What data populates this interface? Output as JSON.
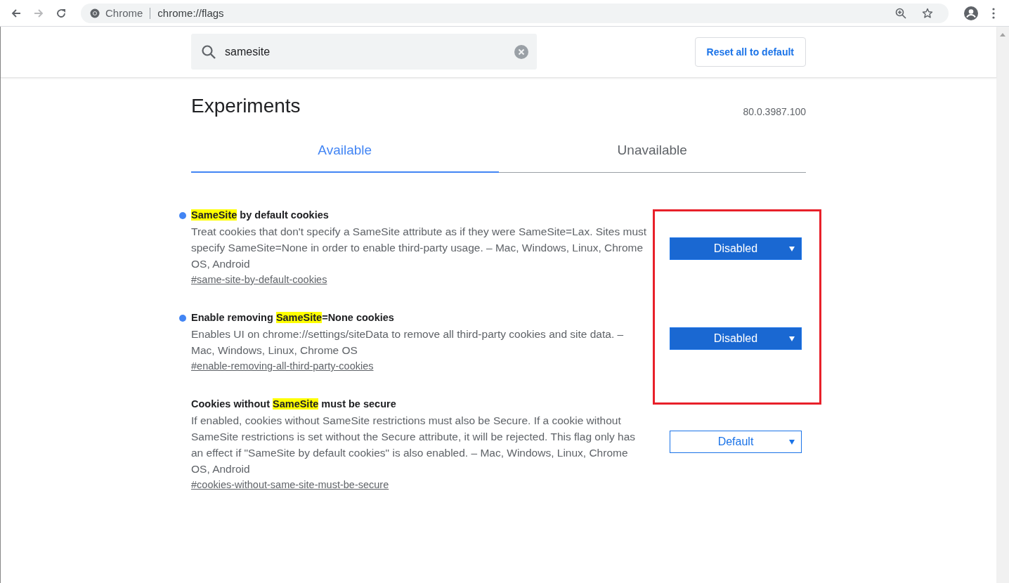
{
  "toolbar": {
    "origin_label": "Chrome",
    "url": "chrome://flags",
    "forward_disabled": true
  },
  "search": {
    "value": "samesite"
  },
  "reset_button": "Reset all to default",
  "title": "Experiments",
  "version": "80.0.3987.100",
  "tabs": [
    {
      "label": "Available",
      "selected": true
    },
    {
      "label": "Unavailable",
      "selected": false
    }
  ],
  "flags": [
    {
      "title_parts": [
        {
          "text": "SameSite",
          "highlighted": true
        },
        {
          "text": " by default cookies",
          "highlighted": false
        }
      ],
      "modified": true,
      "description": "Treat cookies that don't specify a SameSite attribute as if they were SameSite=Lax. Sites must specify SameSite=None in order to enable third-party usage. – Mac, Windows, Linux, Chrome OS, Android",
      "link": "#same-site-by-default-cookies",
      "value": "Disabled"
    },
    {
      "title_parts": [
        {
          "text": "Enable removing ",
          "highlighted": false
        },
        {
          "text": "SameSite",
          "highlighted": true
        },
        {
          "text": "=None cookies",
          "highlighted": false
        }
      ],
      "modified": true,
      "description": "Enables UI on chrome://settings/siteData to remove all third-party cookies and site data. – Mac, Windows, Linux, Chrome OS",
      "link": "#enable-removing-all-third-party-cookies",
      "value": "Disabled"
    },
    {
      "title_parts": [
        {
          "text": "Cookies without ",
          "highlighted": false
        },
        {
          "text": "SameSite",
          "highlighted": true
        },
        {
          "text": " must be secure",
          "highlighted": false
        }
      ],
      "modified": false,
      "description": "If enabled, cookies without SameSite restrictions must also be Secure. If a cookie without SameSite restrictions is set without the Secure attribute, it will be rejected. This flag only has an effect if \"SameSite by default cookies\" is also enabled. – Mac, Windows, Linux, Chrome OS, Android",
      "link": "#cookies-without-same-site-must-be-secure",
      "value": "Default"
    }
  ]
}
